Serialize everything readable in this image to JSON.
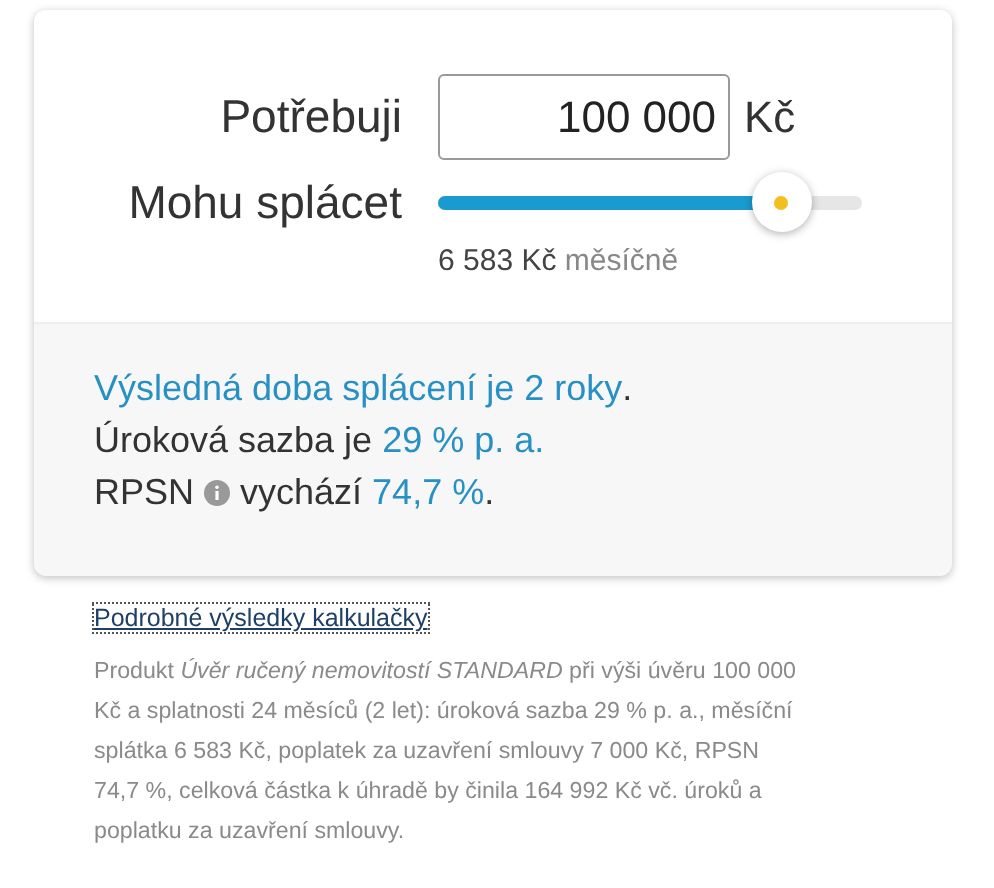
{
  "calculator": {
    "amount_label": "Potřebuji",
    "amount_value": "100 000",
    "amount_unit": "Kč",
    "payment_label": "Mohu splácet",
    "payment_slider": {
      "level": 0.81
    },
    "payment_amount": "6 583 Kč",
    "payment_period": "měsíčně"
  },
  "results": [
    {
      "segments": [
        {
          "kind": "text",
          "text": "Výsledná doba splácení je 2 roky",
          "highlight": true
        },
        {
          "kind": "text",
          "text": ".",
          "highlight": false
        }
      ]
    },
    {
      "segments": [
        {
          "kind": "text",
          "text": "Úroková sazba je ",
          "highlight": false
        },
        {
          "kind": "text",
          "text": "29 % p. a.",
          "highlight": true
        }
      ]
    },
    {
      "segments": [
        {
          "kind": "text",
          "text": "RPSN",
          "highlight": false
        },
        {
          "kind": "info"
        },
        {
          "kind": "text",
          "text": "vychází ",
          "highlight": false
        },
        {
          "kind": "text",
          "text": "74,7 %",
          "highlight": true
        },
        {
          "kind": "text",
          "text": ".",
          "highlight": false
        }
      ]
    }
  ],
  "details_link": "Podrobné výsledky kalkulačky",
  "disclaimer": "Produkt *Úvěr ručený nemovitostí STANDARD* při výši úvěru 100 000 Kč a splatnosti 24 měsíců (2 let): úroková sazba 29 % p. a., měsíční splátka 6 583 Kč, poplatek za uzavření smlouvy 7 000 Kč, RPSN 74,7 %, celková částka k úhradě by činila 164 992 Kč vč. úroků a poplatku za uzavření smlouvy."
}
